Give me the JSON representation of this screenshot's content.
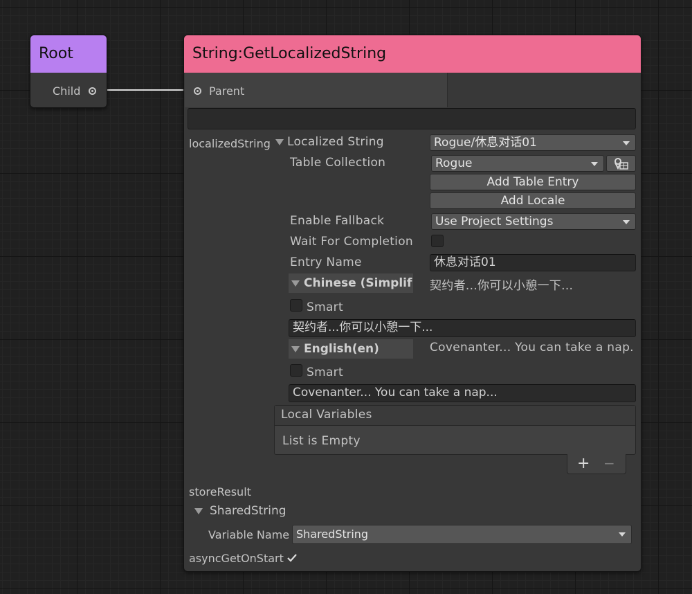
{
  "root_node": {
    "title": "Root",
    "port_label": "Child",
    "header_color": "#b87ff0"
  },
  "main_node": {
    "title": "String:GetLocalizedString",
    "header_color": "#ee6c92",
    "parent_port_label": "Parent",
    "empty_field_value": "",
    "localized_string_label": "localizedString",
    "localized_string_foldout": "Localized String",
    "localized_string_value": "Rogue/休息对话01",
    "table_collection_label": "Table Collection",
    "table_collection_value": "Rogue",
    "table_collection_icon": "locale-map-icon",
    "add_table_entry_label": "Add Table Entry",
    "add_locale_label": "Add Locale",
    "enable_fallback_label": "Enable Fallback",
    "enable_fallback_value": "Use Project Settings",
    "wait_for_completion_label": "Wait For Completion",
    "wait_for_completion_checked": false,
    "entry_name_label": "Entry Name",
    "entry_name_value": "休息对话01",
    "locales": [
      {
        "name": "Chinese (Simplif",
        "preview": "契约者...你可以小憩一下...",
        "smart_label": "Smart",
        "smart_checked": false,
        "value": "契约者...你可以小憩一下..."
      },
      {
        "name": "English(en)",
        "preview": "Covenanter... You can take a nap.",
        "smart_label": "Smart",
        "smart_checked": false,
        "value": "Covenanter... You can take a nap..."
      }
    ],
    "local_variables": {
      "title": "Local Variables",
      "empty_text": "List is Empty",
      "add_label": "+",
      "remove_label": "−"
    },
    "store_result_label": "storeResult",
    "shared_string_foldout": "SharedString",
    "variable_name_label": "Variable Name",
    "variable_name_value": "SharedString",
    "async_get_on_start_label": "asyncGetOnStart",
    "async_get_on_start_checked": true
  }
}
